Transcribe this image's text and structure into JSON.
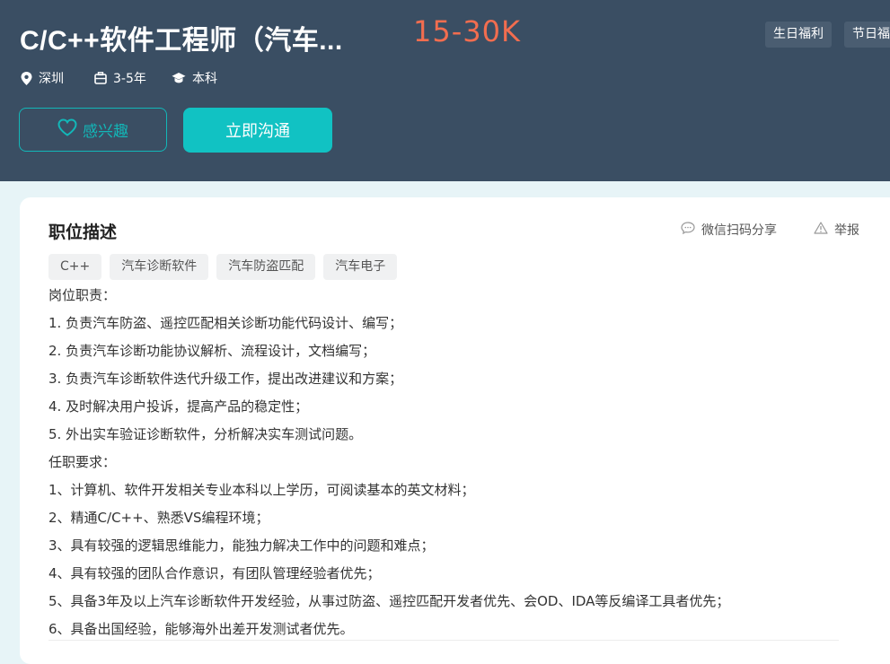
{
  "job": {
    "title": "C/C++软件工程师（汽车...",
    "salary": "15-30K",
    "welfare": [
      "生日福利",
      "节日福利"
    ],
    "meta": {
      "location": "深圳",
      "experience": "3-5年",
      "education": "本科"
    }
  },
  "actions": {
    "like_label": "感兴趣",
    "chat_label": "立即沟通"
  },
  "description": {
    "section_title": "职位描述",
    "share_label": "微信扫码分享",
    "report_label": "举报",
    "tags": [
      "C++",
      "汽车诊断软件",
      "汽车防盗匹配",
      "汽车电子"
    ],
    "lines": [
      "岗位职责：",
      "1. 负责汽车防盗、遥控匹配相关诊断功能代码设计、编写；",
      "2. 负责汽车诊断功能协议解析、流程设计，文档编写；",
      "3. 负责汽车诊断软件迭代升级工作，提出改进建议和方案；",
      "4. 及时解决用户投诉，提高产品的稳定性；",
      "5. 外出实车验证诊断软件，分析解决实车测试问题。",
      "任职要求：",
      "1、计算机、软件开发相关专业本科以上学历，可阅读基本的英文材料；",
      "2、精通C/C++、熟悉VS编程环境；",
      "3、具有较强的逻辑思维能力，能独力解决工作中的问题和难点；",
      "4、具有较强的团队合作意识，有团队管理经验者优先；",
      "5、具备3年及以上汽车诊断软件开发经验，从事过防盗、遥控匹配开发者优先、会OD、IDA等反编译工具者优先；",
      "6、具备出国经验，能够海外出差开发测试者优先。"
    ]
  },
  "colors": {
    "header_bg": "#3a4e63",
    "salary": "#f26d4f",
    "accent": "#11c2c3"
  }
}
